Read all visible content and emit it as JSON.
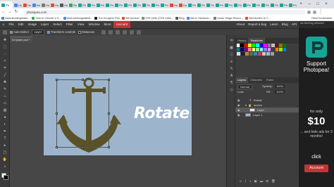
{
  "browser": {
    "tabs": [
      {
        "label": "Ph",
        "color": "#18a497"
      },
      {
        "label": "Ho",
        "color": "#4285f4"
      },
      {
        "label": "Ho",
        "color": "#ea4335"
      },
      {
        "label": "Re",
        "color": "#4285f4"
      },
      {
        "label": "Ho",
        "color": "#777777"
      },
      {
        "label": "Ho",
        "color": "#e44d26"
      },
      {
        "label": "Ho",
        "color": "#555555"
      },
      {
        "label": "Re",
        "color": "#34a853"
      },
      {
        "label": "Ph",
        "color": "#18a497"
      },
      {
        "label": "Ph",
        "color": "#18a497"
      },
      {
        "label": "Ph",
        "color": "#18a497"
      },
      {
        "label": "Ph",
        "color": "#18a497"
      },
      {
        "label": "Ph",
        "color": "#18a497"
      },
      {
        "label": "Ph",
        "color": "#18a497"
      },
      {
        "label": "Ph",
        "color": "#18a497"
      },
      {
        "label": "Ph",
        "color": "#18a497"
      },
      {
        "label": "Ph",
        "color": "#18a497"
      },
      {
        "label": "Ph",
        "color": "#18a497"
      },
      {
        "label": "Ho",
        "color": "#ea4335"
      },
      {
        "label": "Do",
        "color": "#e44d26"
      },
      {
        "label": "Ph",
        "color": "#18a497"
      },
      {
        "label": "Ph",
        "color": "#18a497"
      },
      {
        "label": "Ph",
        "color": "#18a497"
      },
      {
        "label": "Ph",
        "color": "#18a497"
      },
      {
        "label": "Ph",
        "color": "#18a497"
      },
      {
        "label": "Ph",
        "color": "#18a497"
      },
      {
        "label": "Ph",
        "color": "#18a497"
      },
      {
        "label": "Ph",
        "color": "#18a497"
      },
      {
        "label": "Ph",
        "color": "#18a497"
      },
      {
        "label": "Ph",
        "color": "#18a497"
      },
      {
        "label": "Ph",
        "color": "#18a497"
      },
      {
        "label": "Ph",
        "color": "#18a497"
      }
    ],
    "url": "photopea.com",
    "bookmarks": [
      {
        "label": "www.amazingstatis...",
        "color": "#4285f4"
      },
      {
        "label": "How to Choose a G...",
        "color": "#34a853"
      },
      {
        "label": "www.bankingstatisti...",
        "color": "#4285f4"
      },
      {
        "label": "The Dungeon Run",
        "color": "#222222"
      },
      {
        "label": "SM product",
        "color": "#ea4335"
      },
      {
        "label": "CSS Units (CSS Units...",
        "color": "#888888"
      },
      {
        "label": "Blog",
        "color": "#555555"
      },
      {
        "label": "Aaron Yankauer...",
        "color": "#4285f4"
      },
      {
        "label": "Jonas' Magic Resou...",
        "color": "#777777"
      },
      {
        "label": "Introduction to C...",
        "color": "#ea4335"
      }
    ],
    "other_bookmarks": "Other bookmarks"
  },
  "menubar": {
    "items": [
      "File",
      "Edit",
      "Image",
      "Layer",
      "Select",
      "Filter",
      "View",
      "Window",
      "More"
    ],
    "account": "Account",
    "right": [
      "About",
      "Report a bug",
      "Learn",
      "Blog",
      "API"
    ]
  },
  "options": {
    "auto_select": "Auto-Select",
    "layer_select": "Layer",
    "transform_controls": "Transform controls",
    "distances": "Distances"
  },
  "document": {
    "tab": "template.psd *",
    "canvas_text": "Rotate"
  },
  "panels": {
    "top_tabs": [
      "History",
      "Swatches"
    ],
    "swatch_colors": [
      [
        "#ffffff",
        "#000000",
        "#ff0000",
        "#ffff00",
        "#00ff00",
        "#00ffff",
        "#0000ff",
        "#ff00ff",
        "#808080",
        "#c0c0c0",
        "#800000",
        "#808000",
        "#008000"
      ],
      [
        "#008080",
        "#000080",
        "#800080",
        "#ff8080",
        "#ffff80",
        "#80ff80",
        "#80ffff",
        "#8080ff",
        "#ff80ff",
        "#404040",
        "#ff8000",
        "#80ff00",
        "#0080ff"
      ],
      [
        "#e0e0e0",
        "#202020",
        "#c08040",
        "#408040",
        "#4080c0",
        "#c04080",
        "#f0c090",
        "#90c0f0",
        "#a0a0a0"
      ]
    ],
    "layer_tabs": [
      "Layers",
      "Channels",
      "Paths"
    ],
    "blend_mode": "Normal",
    "opacity_label": "Opacity:",
    "opacity_value": "100%",
    "lock_label": "Lock:",
    "fill_label": "Fill:",
    "fill_value": "100%",
    "layers": [
      {
        "name": "Rotate",
        "type": "text"
      },
      {
        "name": "anchor",
        "type": "group"
      },
      {
        "name": "Layer",
        "type": "layer"
      },
      {
        "name": "Layer 1",
        "type": "layer"
      }
    ]
  },
  "ad": {
    "top_text": "Ad-blocking detected",
    "headline": "Support Photopea!",
    "for_only": "for only",
    "price": "$10",
    "sub": "... and hide ads for 3 months!",
    "click": "click",
    "button": "Account"
  },
  "colors": {
    "accent": "#c03535",
    "brand": "#18a497",
    "canvas_bg": "#9cb4cc",
    "anchor": "#5a5228"
  }
}
